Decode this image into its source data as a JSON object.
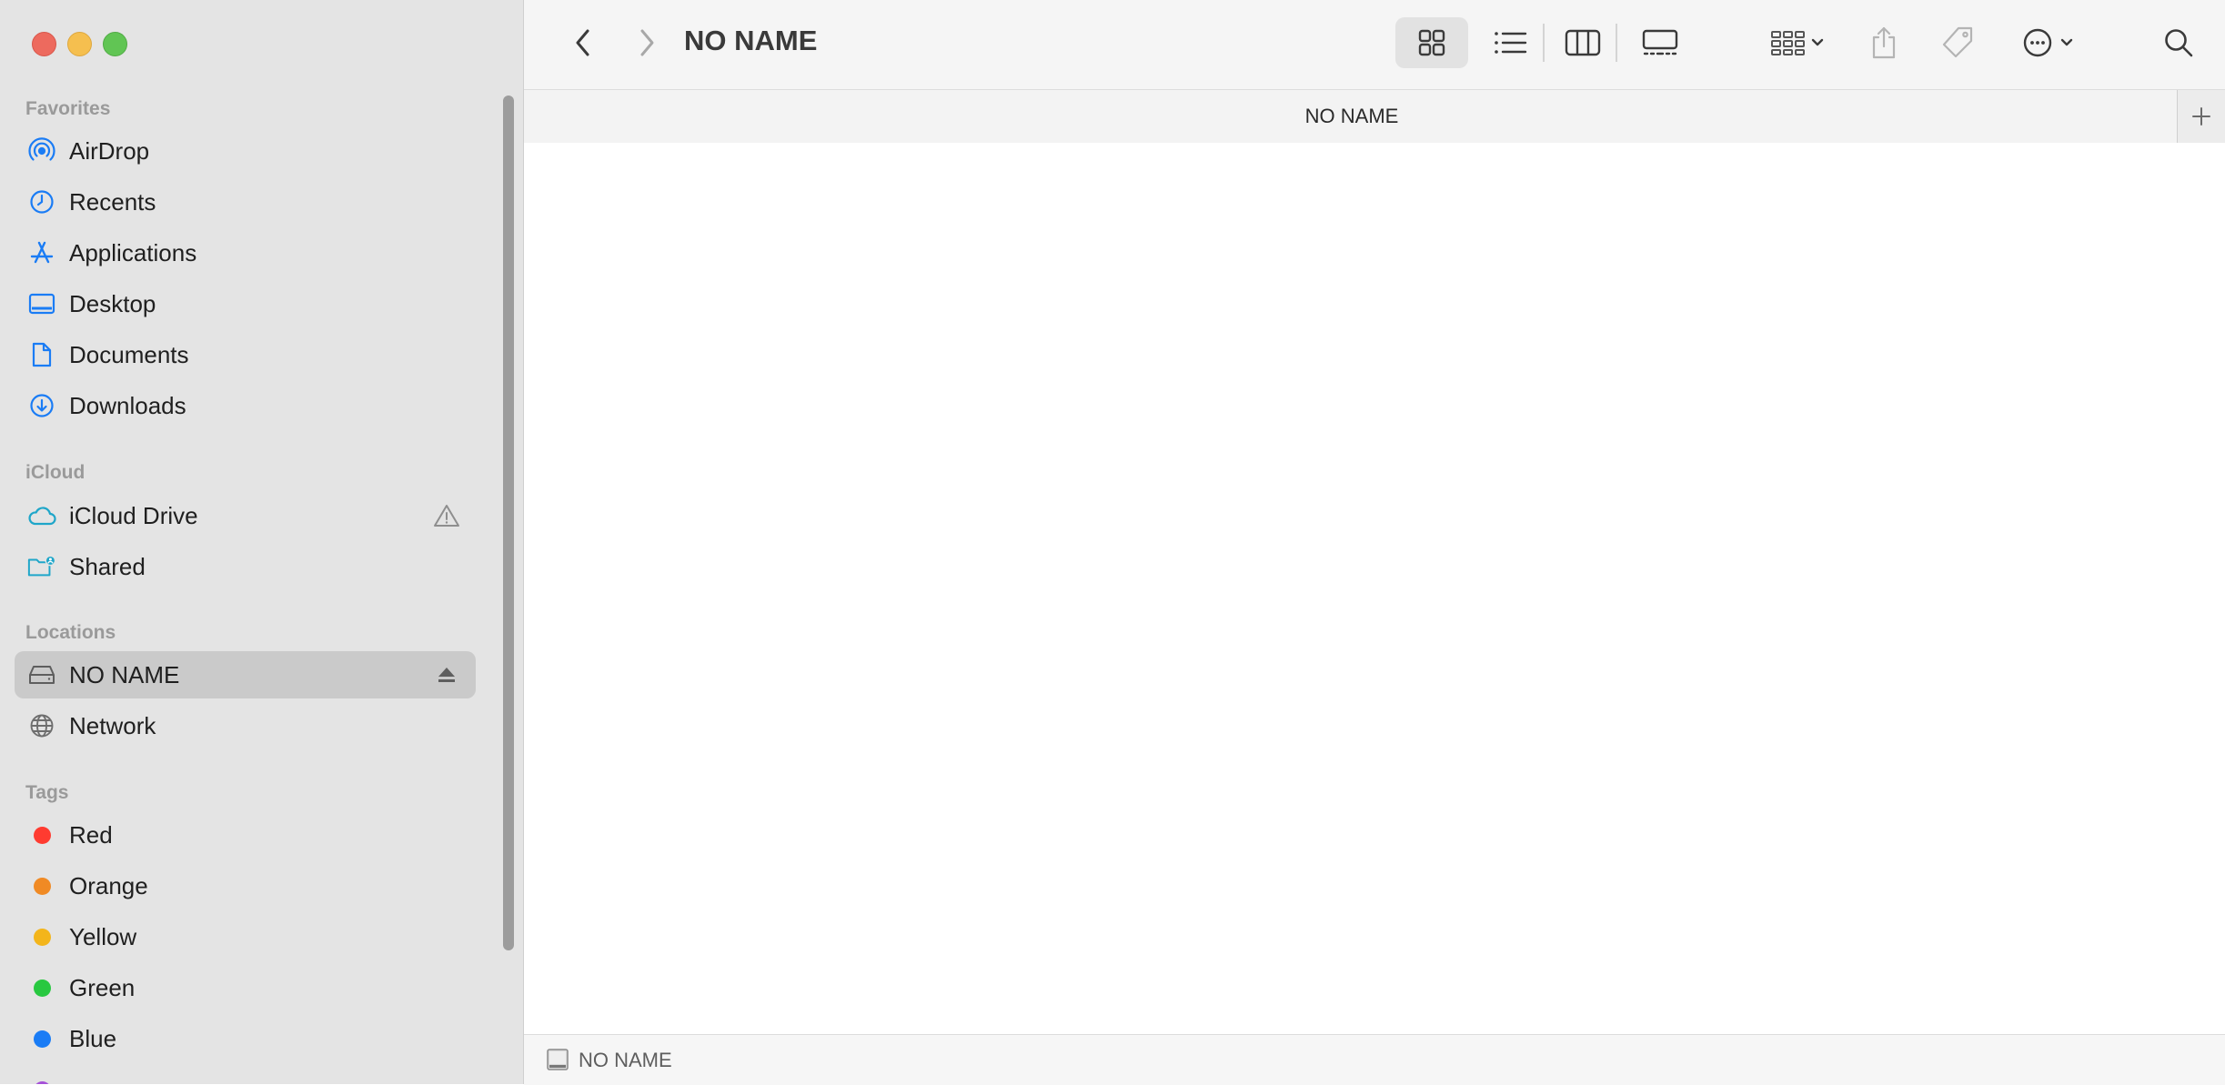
{
  "window": {
    "title": "NO NAME"
  },
  "sidebar": {
    "sections": [
      {
        "header": "Favorites",
        "items": [
          {
            "label": "AirDrop",
            "icon": "airdrop-icon"
          },
          {
            "label": "Recents",
            "icon": "clock-icon"
          },
          {
            "label": "Applications",
            "icon": "applications-icon"
          },
          {
            "label": "Desktop",
            "icon": "desktop-icon"
          },
          {
            "label": "Documents",
            "icon": "document-icon"
          },
          {
            "label": "Downloads",
            "icon": "download-icon"
          }
        ]
      },
      {
        "header": "iCloud",
        "items": [
          {
            "label": "iCloud Drive",
            "icon": "cloud-icon",
            "trailing_icon": "warning-icon"
          },
          {
            "label": "Shared",
            "icon": "shared-folder-icon"
          }
        ]
      },
      {
        "header": "Locations",
        "items": [
          {
            "label": "NO NAME",
            "icon": "drive-icon",
            "trailing_icon": "eject-icon",
            "selected": true
          },
          {
            "label": "Network",
            "icon": "globe-icon"
          }
        ]
      },
      {
        "header": "Tags",
        "items": [
          {
            "label": "Red",
            "color": "#ff3b30"
          },
          {
            "label": "Orange",
            "color": "#f08a24"
          },
          {
            "label": "Yellow",
            "color": "#f3b51b"
          },
          {
            "label": "Green",
            "color": "#28c840"
          },
          {
            "label": "Blue",
            "color": "#1a7cf5"
          }
        ]
      }
    ]
  },
  "toolbar": {
    "icons": [
      "back-icon",
      "forward-icon",
      "icon-view-icon",
      "list-view-icon",
      "column-view-icon",
      "gallery-view-icon",
      "group-icon",
      "share-icon",
      "tag-icon",
      "more-icon",
      "search-icon"
    ],
    "active_view": "icon-view"
  },
  "pathbar": {
    "title": "NO NAME"
  },
  "statusbar": {
    "label": "NO NAME"
  },
  "colors": {
    "accent": "#1a7cf5",
    "sidebar_bg": "#e4e4e4",
    "selected_bg": "#cacaca"
  }
}
